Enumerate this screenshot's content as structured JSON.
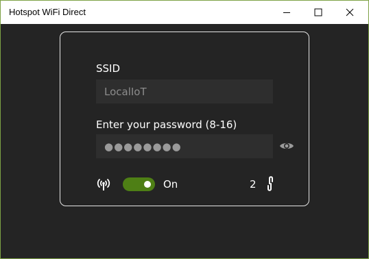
{
  "window": {
    "title": "Hotspot WiFi Direct",
    "minimize_icon": "minimize-icon",
    "maximize_icon": "maximize-icon",
    "close_icon": "close-icon"
  },
  "form": {
    "ssid_label": "SSID",
    "ssid_placeholder": "LocalIoT",
    "ssid_value": "",
    "password_label": "Enter your password (8-16)",
    "password_value": "●●●●●●●●",
    "show_password_icon": "eye-icon"
  },
  "status": {
    "hotspot_icon": "antenna-icon",
    "toggle_state": "on",
    "toggle_label": "On",
    "connected_clients": "2",
    "clients_icon": "link-icon"
  },
  "colors": {
    "accent": "#4e7f15",
    "window_border": "#7da145",
    "background": "#242424",
    "field_background": "#2e2e2e",
    "card_border": "#e6e6e6"
  }
}
